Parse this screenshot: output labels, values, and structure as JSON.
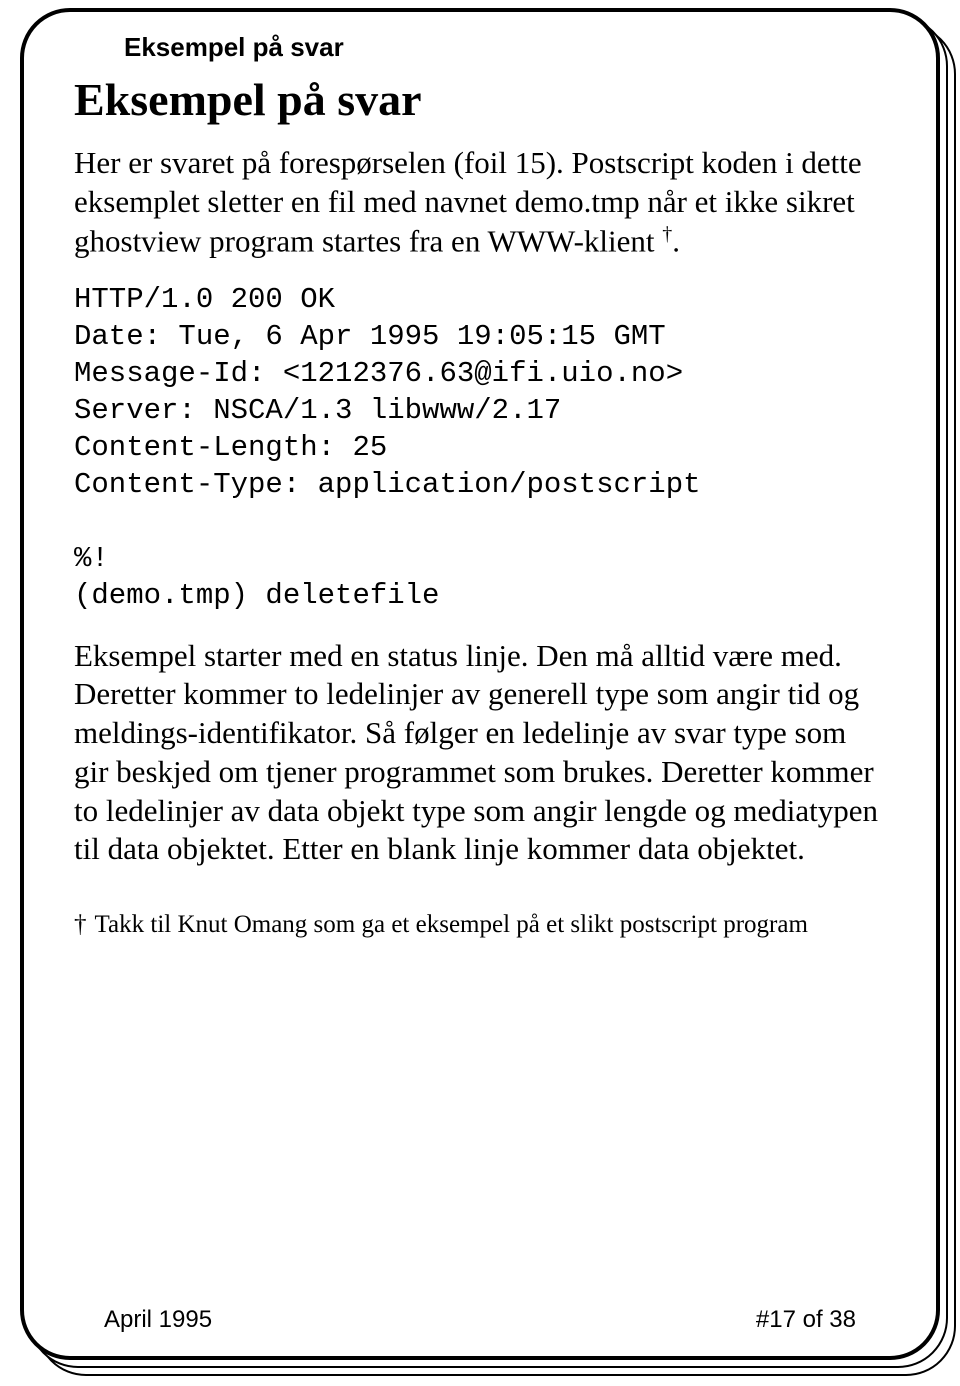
{
  "header": {
    "label": "Eksempel på svar"
  },
  "title": "Eksempel på svar",
  "intro": {
    "text_before_dagger": "Her er svaret på forespørselen (foil 15). Postscript koden i dette eksemplet sletter en fil med navnet demo.tmp når et ikke sikret ghostview program startes fra en WWW-klient ",
    "dagger": "†",
    "text_after_dagger": "."
  },
  "code": "HTTP/1.0 200 OK\nDate: Tue, 6 Apr 1995 19:05:15 GMT\nMessage-Id: <1212376.63@ifi.uio.no>\nServer: NSCA/1.3 libwww/2.17\nContent-Length: 25\nContent-Type: application/postscript\n\n%!\n(demo.tmp) deletefile",
  "body": "Eksempel starter med en status linje. Den må alltid være med. Deretter kommer to ledelinjer av generell type som angir tid og meldings-identifikator. Så følger en ledelinje av svar type som gir beskjed om tjener programmet som brukes. Deretter kommer to ledelinjer av data objekt type som angir lengde og mediatypen til data objektet. Etter en blank linje kommer data objektet.",
  "footnote": {
    "mark": "†",
    "text": "Takk til Knut Omang som ga et eksempel på et slikt postscript program"
  },
  "footer": {
    "date": "April 1995",
    "page": "#17 of 38"
  }
}
